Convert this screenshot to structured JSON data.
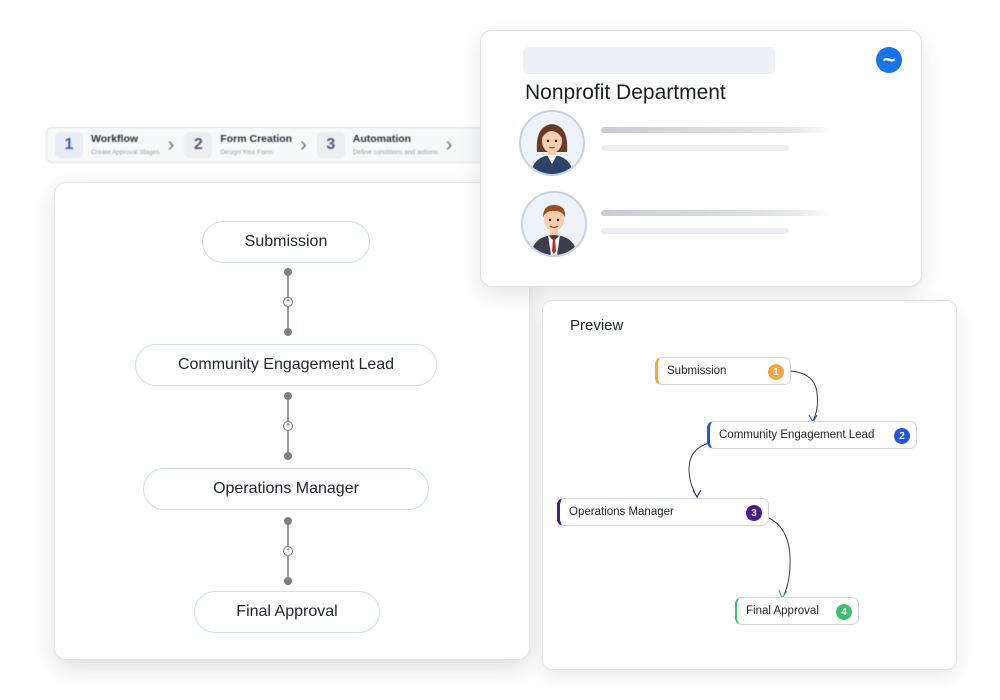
{
  "stepper": {
    "steps": [
      {
        "num": "1",
        "title": "Workflow",
        "subtitle": "Create Approval Stages"
      },
      {
        "num": "2",
        "title": "Form Creation",
        "subtitle": "Design Your Form"
      },
      {
        "num": "3",
        "title": "Automation",
        "subtitle": "Define conditions and actions"
      }
    ]
  },
  "workflow": {
    "nodes": [
      "Submission",
      "Community Engagement Lead",
      "Operations Manager",
      "Final Approval"
    ],
    "connector_icon": "plus-circle-icon"
  },
  "department": {
    "title": "Nonprofit Department",
    "logo_icon": "wave-logo-icon",
    "logo_color": "#1a73e8",
    "members": [
      {
        "avatar_icon": "female-avatar-icon"
      },
      {
        "avatar_icon": "male-avatar-icon"
      }
    ]
  },
  "preview": {
    "title": "Preview",
    "nodes": [
      {
        "label": "Submission",
        "badge": "1",
        "color": "#f5a742"
      },
      {
        "label": "Community Engagement Lead",
        "badge": "2",
        "color": "#2457d6"
      },
      {
        "label": "Operations Manager",
        "badge": "3",
        "color": "#4b1a8c"
      },
      {
        "label": "Final Approval",
        "badge": "4",
        "color": "#3cbf6e"
      }
    ]
  }
}
